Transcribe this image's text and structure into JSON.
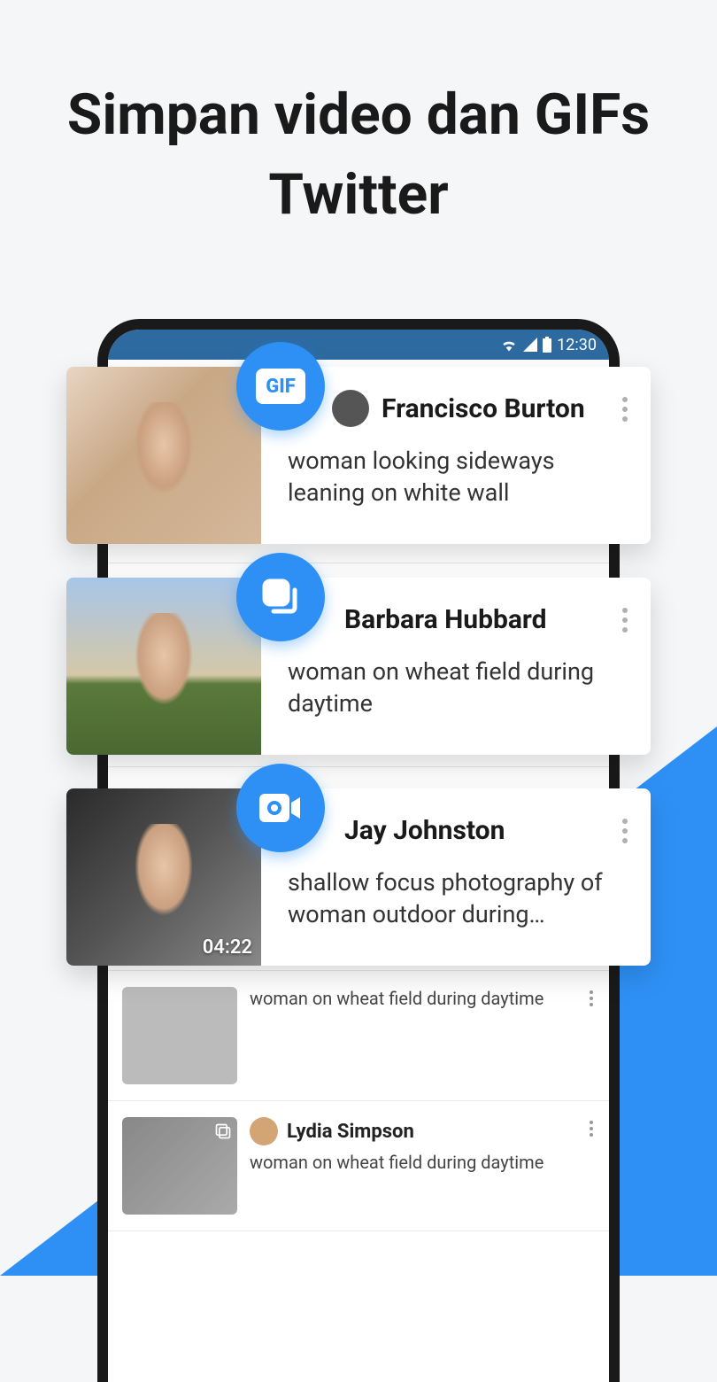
{
  "headline": "Simpan video dan GIFs Twitter",
  "status_bar": {
    "time": "12:30"
  },
  "badges": {
    "gif": "GIF"
  },
  "cards": [
    {
      "name": "Francisco Burton",
      "desc": "woman looking sideways leaning on white wall",
      "type": "gif",
      "duration": ""
    },
    {
      "name": "Barbara Hubbard",
      "desc": "woman on wheat field during daytime",
      "type": "multi",
      "duration": ""
    },
    {
      "name": "Jay Johnston",
      "desc": "shallow focus photography of woman outdoor during…",
      "type": "video",
      "duration": "04:22"
    }
  ],
  "bg_items": [
    {
      "name": "",
      "desc": "woman on wheat field during daytime"
    },
    {
      "name": "Lydia Simpson",
      "desc": "woman on wheat field during daytime"
    }
  ]
}
